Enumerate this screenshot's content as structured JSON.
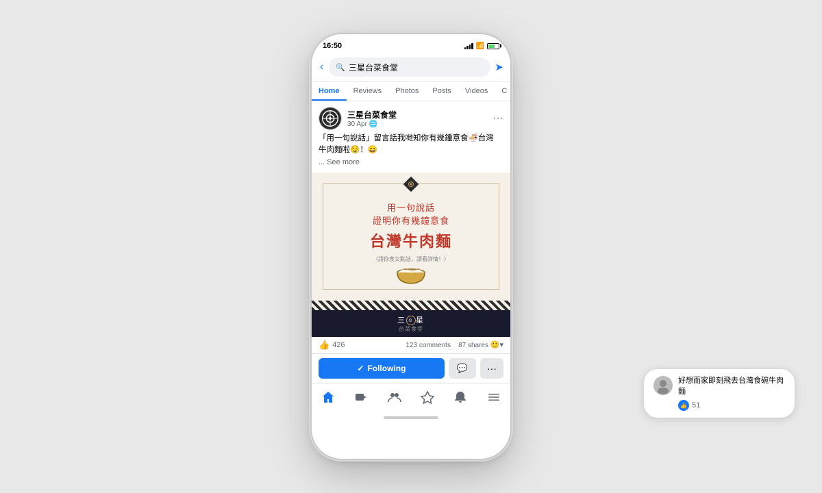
{
  "scene": {
    "background": "#e8e8e8"
  },
  "status_bar": {
    "time": "16:50",
    "signal_icon": "signal-icon",
    "wifi_icon": "wifi-icon",
    "battery_icon": "battery-icon"
  },
  "search_bar": {
    "back_label": "‹",
    "search_placeholder": "三星台菜食堂",
    "search_icon": "search-icon",
    "share_icon": "share-icon"
  },
  "tabs": [
    {
      "label": "Home",
      "active": true
    },
    {
      "label": "Reviews",
      "active": false
    },
    {
      "label": "Photos",
      "active": false
    },
    {
      "label": "Posts",
      "active": false
    },
    {
      "label": "Videos",
      "active": false
    },
    {
      "label": "C",
      "active": false
    }
  ],
  "post": {
    "page_name": "三星台菜食堂",
    "post_date": "30 Apr",
    "globe_icon": "globe-icon",
    "more_icon": "more-icon",
    "text_line1": "「用一句說話」留言話我哋知你有幾鍾意食🍜台灣",
    "text_line2": "牛肉麵啦🤤！😄",
    "see_more": "... See more",
    "poster": {
      "line1": "用一句說話",
      "line2": "證明你有幾鐘意食",
      "line3": "台灣牛肉麵",
      "sub_text": "（請你食又點話，請看詳情！）",
      "bottom_logo": "三⊙星",
      "bottom_sub": "台菜食堂"
    },
    "reactions": {
      "icon": "👍",
      "count": "426"
    },
    "comments": "123 comments",
    "shares": "87 shares",
    "following_label": "Following",
    "following_icon": "✓",
    "messenger_icon": "💬",
    "more_actions_icon": "···"
  },
  "bottom_nav": [
    {
      "icon": "⌂",
      "label": "home",
      "active": true
    },
    {
      "icon": "▶",
      "label": "video",
      "active": false
    },
    {
      "icon": "👥",
      "label": "groups",
      "active": false
    },
    {
      "icon": "⚑",
      "label": "pages",
      "active": false
    },
    {
      "icon": "🔔",
      "label": "notifications",
      "active": false
    },
    {
      "icon": "≡",
      "label": "menu",
      "active": false
    }
  ],
  "comment_bubble": {
    "text": "好想而家即刻飛去台灣食碗牛肉麵",
    "like_count": "51",
    "like_icon": "👍"
  }
}
